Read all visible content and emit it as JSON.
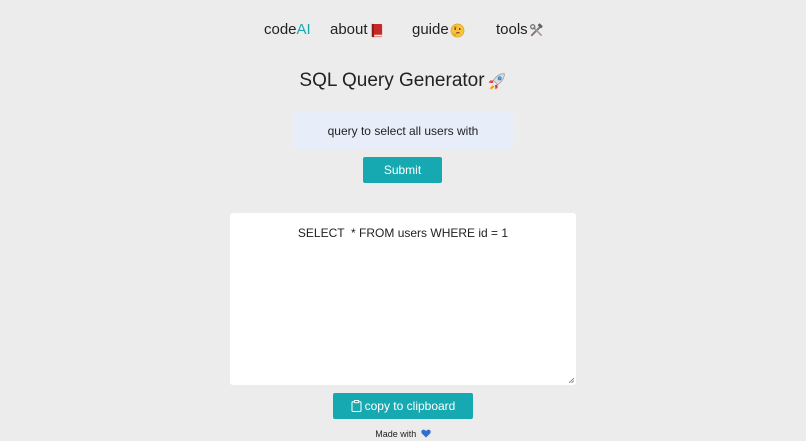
{
  "nav": {
    "brand_prefix": "code",
    "brand_suffix": "AI",
    "about_label": "about",
    "about_icon": "red-book-icon",
    "guide_label": "guide",
    "guide_icon": "thinking-face-icon",
    "tools_label": "tools",
    "tools_icon": "hammer-and-wrench-icon"
  },
  "page": {
    "title": "SQL Query Generator",
    "title_icon": "rocket-icon"
  },
  "prompt": {
    "value": "query to select all users with"
  },
  "submit_label": "Submit",
  "output": {
    "text": "SELECT  * FROM users WHERE id = 1"
  },
  "copy": {
    "label": "copy to clipboard",
    "icon": "clipboard-icon"
  },
  "footer": {
    "text": "Made with",
    "icon": "blue-heart-icon"
  },
  "colors": {
    "accent": "#17a9b1",
    "background": "#ececec",
    "input_bg": "#e7eef9",
    "output_bg": "#ffffff"
  }
}
